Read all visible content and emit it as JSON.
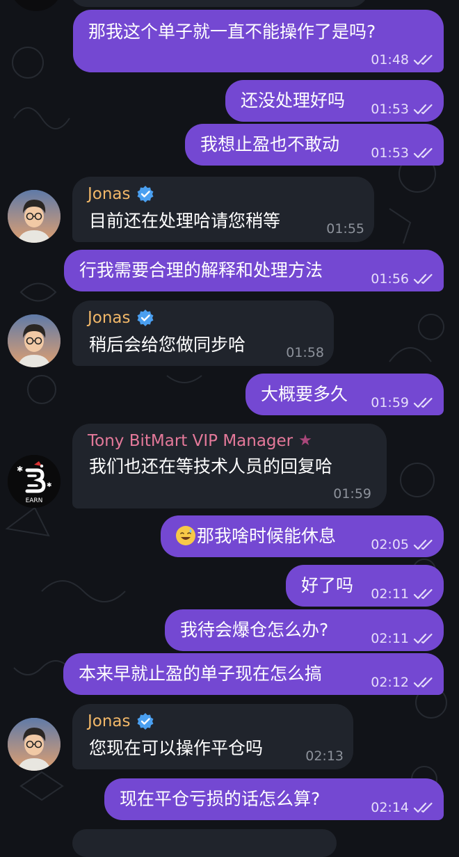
{
  "colors": {
    "background": "#111318",
    "outgoing_bubble": "#7448d2",
    "incoming_bubble": "#20242c",
    "jonas_name": "#f2b869",
    "tony_name": "#e4799a",
    "verified_badge": "#4a9ff0",
    "incoming_time": "#8d929b",
    "outgoing_time": "#e6defa"
  },
  "messages": [
    {
      "text": "那我这个单子就一直不能操作了是吗?",
      "time": "01:48"
    },
    {
      "text": "还没处理好吗",
      "time": "01:53"
    },
    {
      "text": "我想止盈也不敢动",
      "time": "01:53"
    },
    {
      "sender": "Jonas",
      "text": "目前还在处理哈请您稍等",
      "time": "01:55"
    },
    {
      "text": "行我需要合理的解释和处理方法",
      "time": "01:56"
    },
    {
      "sender": "Jonas",
      "text": "稍后会给您做同步哈",
      "time": "01:58"
    },
    {
      "text": "大概要多久",
      "time": "01:59"
    },
    {
      "sender": "Tony BitMart VIP Manager",
      "text": "我们也还在等技术人员的回复哈",
      "time": "01:59"
    },
    {
      "emoji": "sweat-smile-emoji",
      "text": "那我啥时候能休息",
      "time": "02:05"
    },
    {
      "text": "好了吗",
      "time": "02:11"
    },
    {
      "text": "我待会爆仓怎么办?",
      "time": "02:11"
    },
    {
      "text": "本来早就止盈的单子现在怎么搞",
      "time": "02:12"
    },
    {
      "sender": "Jonas",
      "text": "您现在可以操作平仓吗",
      "time": "02:13"
    },
    {
      "text": "现在平仓亏损的话怎么算?",
      "time": "02:14"
    }
  ],
  "avatars": {
    "jonas": "cartoon-man-glasses-avatar",
    "tony": "bitmart-earn-logo",
    "tony_logo_text": "EARN"
  },
  "icons": {
    "read": "double-check-icon",
    "verified": "verified-badge-icon",
    "premium": "star-icon"
  }
}
